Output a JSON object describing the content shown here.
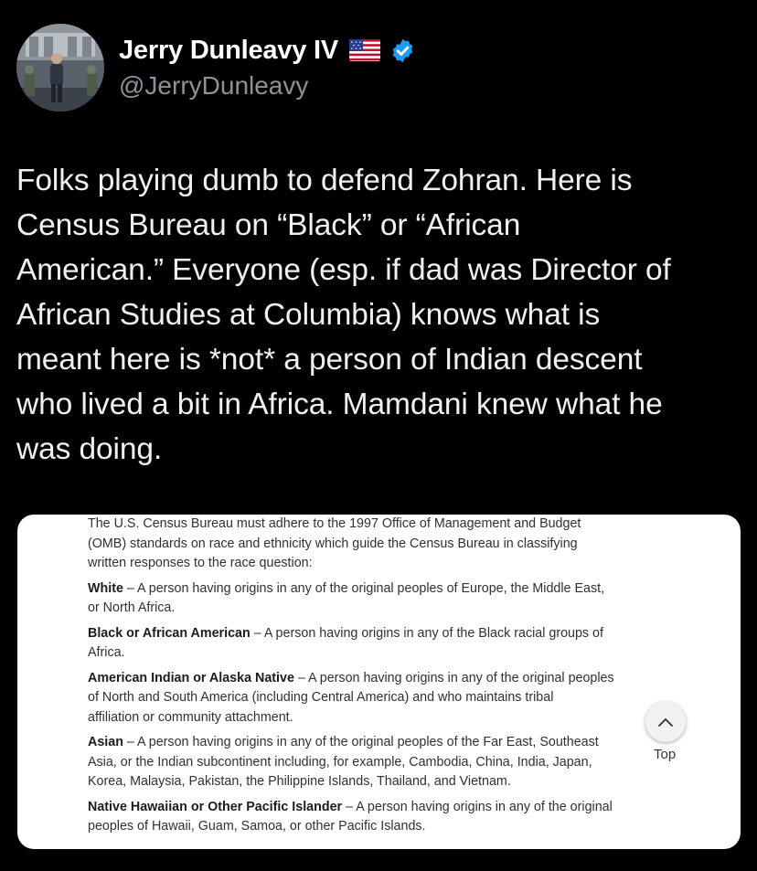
{
  "author": {
    "display_name": "Jerry Dunleavy IV",
    "handle": "@JerryDunleavy",
    "flag_icon": "us-flag-icon",
    "verified_icon": "verified-badge-icon",
    "verified_color": "#1d9bf0"
  },
  "tweet": {
    "lines": [
      "Folks playing dumb to defend Zohran. Here is",
      "Census Bureau on “Black” or “African",
      "American.” Everyone (esp. if dad was Director of",
      "African Studies at Columbia) knows what is",
      "meant here is *not* a person of Indian descent",
      "who lived a bit in Africa. Mamdani knew what he",
      "was doing."
    ]
  },
  "document": {
    "intro_lines": [
      "The U.S. Census Bureau must adhere to the 1997 Office of Management and Budget",
      "(OMB) standards on race and ethnicity which guide the Census Bureau in classifying",
      "written responses to the race question:"
    ],
    "definitions": [
      {
        "term": "White",
        "lines": [
          " – A person having origins in any of the original peoples of Europe, the Middle East,",
          "or North Africa."
        ]
      },
      {
        "term": "Black or African American",
        "lines": [
          " – A person having origins in any of the Black racial groups of",
          "Africa."
        ]
      },
      {
        "term": "American Indian or Alaska Native",
        "lines": [
          " – A person having origins in any of the original peoples",
          "of North and South America (including Central America) and who maintains tribal",
          "affiliation or community attachment."
        ]
      },
      {
        "term": "Asian",
        "lines": [
          " – A person having origins in any of the original peoples of the Far East, Southeast",
          "Asia, or the Indian subcontinent including, for example, Cambodia, China, India, Japan,",
          "Korea, Malaysia, Pakistan, the Philippine Islands, Thailand, and Vietnam."
        ]
      },
      {
        "term": "Native Hawaiian or Other Pacific Islander",
        "lines": [
          " – A person having origins in any of the original",
          "peoples of Hawaii, Guam, Samoa, or other Pacific Islands."
        ]
      }
    ],
    "top_button": {
      "icon": "chevron-up-icon",
      "label": "Top"
    }
  }
}
